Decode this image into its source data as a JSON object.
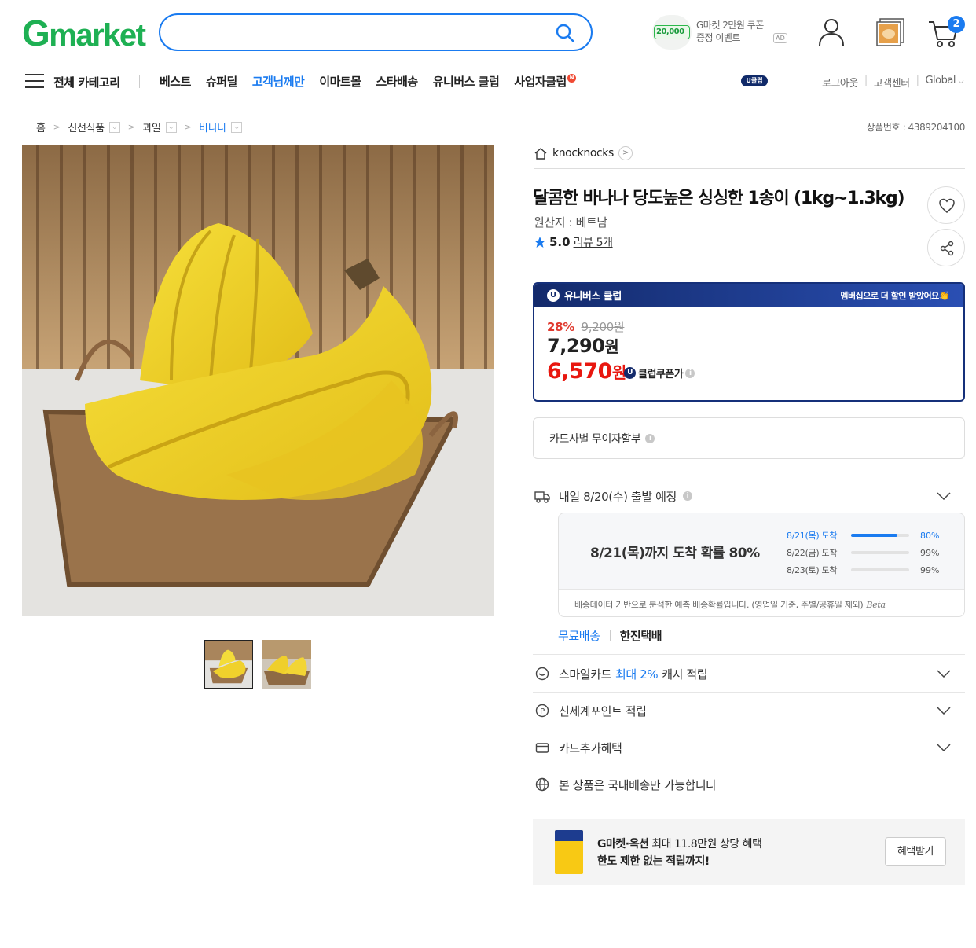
{
  "header": {
    "logo_g": "G",
    "logo_rest": "market",
    "search_placeholder": "",
    "coupon_amount": "20,000",
    "coupon_line1": "G마켓 2만원 쿠폰",
    "coupon_line2": "증정 이벤트",
    "ad_label": "AD",
    "cart_count": "2"
  },
  "nav": {
    "category_label": "전체 카테고리",
    "items": [
      "베스트",
      "슈퍼딜",
      "고객님께만",
      "이마트몰",
      "스타배송",
      "유니버스 클럽",
      "사업자클럽"
    ],
    "new_mark": "N",
    "uclub_badge": "U클럽",
    "util": [
      "로그아웃",
      "고객센터",
      "Global"
    ]
  },
  "breadcrumb": {
    "items": [
      "홈",
      "신선식품",
      "과일",
      "바나나"
    ],
    "product_number": "상품번호 : 4389204100"
  },
  "product": {
    "seller": "knocknocks",
    "title": "달콤한 바나나 당도높은 싱싱한 1송이 (1kg~1.3kg)",
    "origin": "원산지 : 베트남",
    "rating": "5.0",
    "review_label": "리뷰 5개"
  },
  "club": {
    "name": "유니버스 클럽",
    "promo": "멤버십으로 더 할인 받았어요👏",
    "discount_pct": "28%",
    "original_price": "9,200원",
    "price": "7,290",
    "price_unit": "원",
    "club_price": "6,570",
    "club_price_unit": "원",
    "club_label": "클럽쿠폰가"
  },
  "installment": {
    "label": "카드사별 무이자할부"
  },
  "delivery": {
    "header": "내일 8/20(수) 출발 예정",
    "probability_text": "8/21(목)까지 도착 확률 80%",
    "rows": [
      {
        "label": "8/21(목) 도착",
        "percent": "80%",
        "value": 80
      },
      {
        "label": "8/22(금) 도착",
        "percent": "99%",
        "value": 99
      },
      {
        "label": "8/23(토) 도착",
        "percent": "99%",
        "value": 99
      }
    ],
    "note": "배송데이터 기반으로 분석한 예측 배송확률입니다. (영업일 기준, 주별/공휴일 제외)",
    "beta": "Beta",
    "shipping_fee": "무료배송",
    "carrier": "한진택배"
  },
  "benefits": {
    "smile_pre": "스마일카드",
    "smile_hl": "최대 2%",
    "smile_post": "캐시 적립",
    "shinsegae": "신세계포인트 적립",
    "card_extra": "카드추가혜택",
    "domestic": "본 상품은 국내배송만 가능합니다"
  },
  "promo": {
    "line1_bold": "G마켓·옥션",
    "line1_rest": " 최대 11.8만원 상당 혜택",
    "line2": "한도 제한 없는 적립까지!",
    "button": "혜택받기"
  },
  "colors": {
    "accent": "#1a7bf0",
    "logo_green": "#1eb053",
    "sale_red": "#e8170f",
    "club_navy": "#132a6b"
  }
}
